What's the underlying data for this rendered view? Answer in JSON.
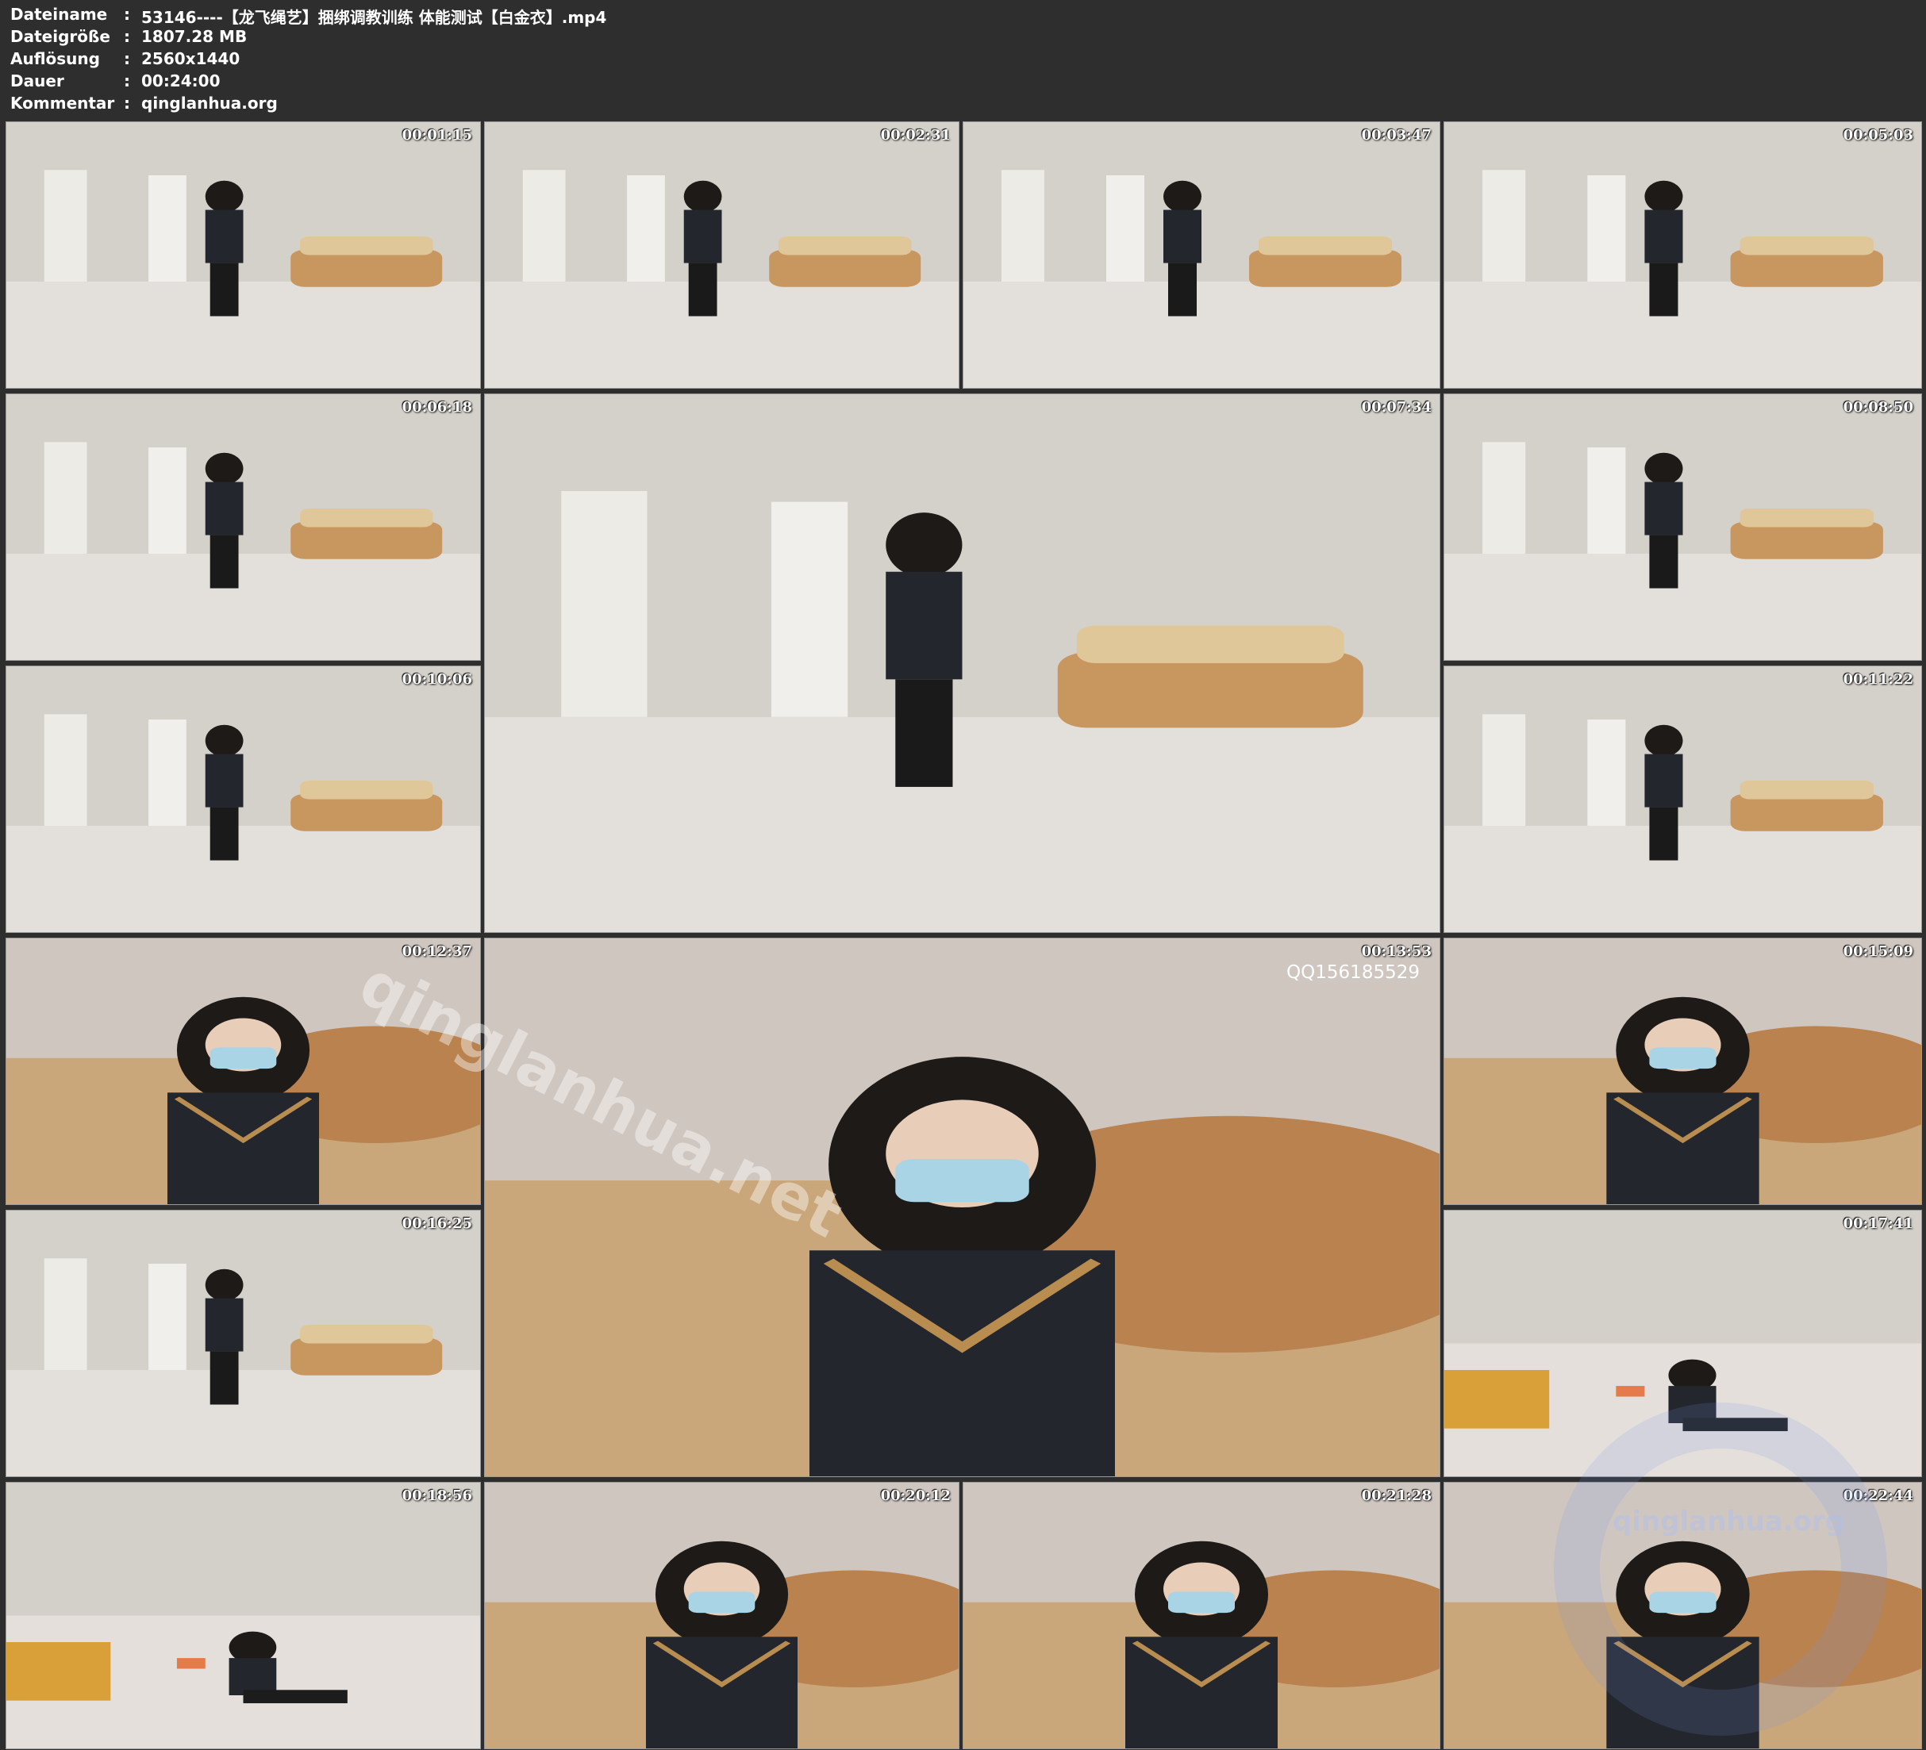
{
  "header": {
    "rows": [
      {
        "key": "Dateiname",
        "sep": ":",
        "value": "53146----【龙飞绳艺】捆绑调教训练 体能测试【白金衣】.mp4"
      },
      {
        "key": "Dateigröße",
        "sep": ":",
        "value": "1807.28 MB"
      },
      {
        "key": "Auflösung",
        "sep": ":",
        "value": "2560x1440"
      },
      {
        "key": "Dauer",
        "sep": ":",
        "value": "00:24:00"
      },
      {
        "key": "Kommentar",
        "sep": ":",
        "value": "qinglanhua.org"
      }
    ]
  },
  "timestamps": [
    "00:01:15",
    "00:02:31",
    "00:03:47",
    "00:05:03",
    "00:06:18",
    "00:07:34",
    "00:08:50",
    "00:10:06",
    "00:11:22",
    "00:12:37",
    "00:13:53",
    "00:15:09",
    "00:16:25",
    "00:17:41",
    "00:18:56",
    "00:20:12",
    "00:21:28",
    "00:22:44"
  ],
  "overlay": {
    "qq_text": "QQ156185529",
    "watermark_diagonal": "qinglanhua.net",
    "watermark_circle": "qinglanhua.org"
  }
}
